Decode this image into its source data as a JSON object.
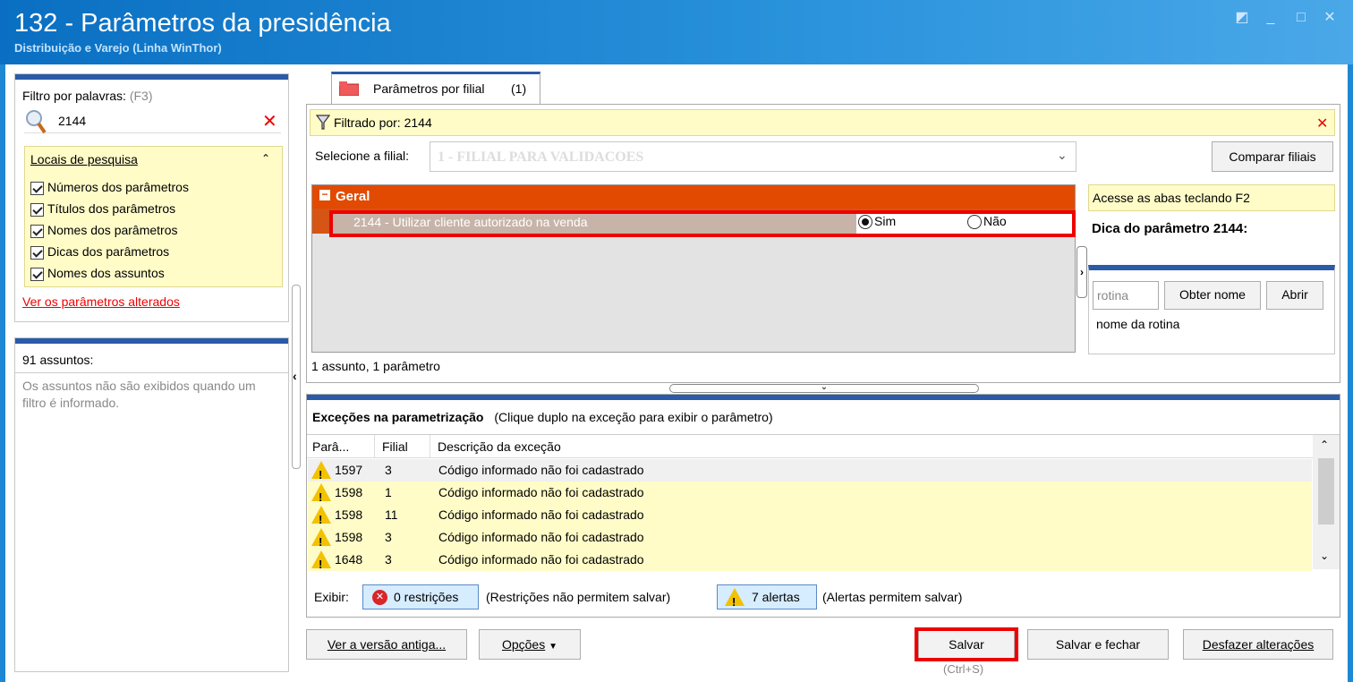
{
  "window": {
    "title": "132 - Parâmetros da presidência",
    "subtitle": "Distribuição e Varejo (Linha WinThor)"
  },
  "left_panel": {
    "filter_label": "Filtro por palavras:",
    "filter_shortcut": "(F3)",
    "search_value": "2144",
    "search_locations_title": "Locais de pesquisa",
    "options": [
      "Números dos parâmetros",
      "Títulos dos parâmetros",
      "Nomes dos parâmetros",
      "Dicas dos parâmetros",
      "Nomes dos assuntos"
    ],
    "changed_link": "Ver os parâmetros alterados",
    "subjects_count": "91 assuntos:",
    "subjects_note": "Os assuntos não são exibidos quando um filtro é informado."
  },
  "tab": {
    "label": "Parâmetros por filial",
    "count": "(1)"
  },
  "filter_bar": {
    "text": "Filtrado por: 2144"
  },
  "branch": {
    "label": "Selecione a filial:",
    "value": "1 - FILIAL PARA VALIDACOES",
    "compare_button": "Comparar filiais"
  },
  "grid": {
    "group": "Geral",
    "param_text": "2144 - Utilizar cliente autorizado na venda",
    "option_yes": "Sim",
    "option_no": "Não",
    "selected": "Sim",
    "summary": "1 assunto, 1 parâmetro"
  },
  "right_panel": {
    "hint": "Acesse as abas teclando F2",
    "tip_title": "Dica do parâmetro 2144:",
    "routine_placeholder": "rotina",
    "get_name_button": "Obter nome",
    "open_button": "Abrir",
    "routine_name": "nome da rotina"
  },
  "exceptions": {
    "title": "Exceções na parametrização",
    "subtitle": "(Clique duplo na exceção para exibir o parâmetro)",
    "columns": [
      "Parâ...",
      "Filial",
      "Descrição da exceção"
    ],
    "rows": [
      {
        "param": "1597",
        "branch": "3",
        "desc": "Código informado não foi cadastrado"
      },
      {
        "param": "1598",
        "branch": "1",
        "desc": "Código informado não foi cadastrado"
      },
      {
        "param": "1598",
        "branch": "11",
        "desc": "Código informado não foi cadastrado"
      },
      {
        "param": "1598",
        "branch": "3",
        "desc": "Código informado não foi cadastrado"
      },
      {
        "param": "1648",
        "branch": "3",
        "desc": "Código informado não foi cadastrado"
      }
    ],
    "show_label": "Exibir:",
    "restrictions_button": "0 restrições",
    "restrictions_note": "(Restrições não permitem salvar)",
    "alerts_button": "7 alertas",
    "alerts_note": "(Alertas permitem salvar)"
  },
  "footer": {
    "old_version_button": "Ver a versão antiga...",
    "options_button": "Opções",
    "save_button": "Salvar",
    "save_shortcut": "(Ctrl+S)",
    "save_close_button": "Salvar e fechar",
    "undo_button": "Desfazer alterações"
  },
  "colors": {
    "title_bar": "#1e88d4",
    "group_header": "#e14a00",
    "highlight": "#e00000",
    "info_yellow": "#fffcc8"
  }
}
